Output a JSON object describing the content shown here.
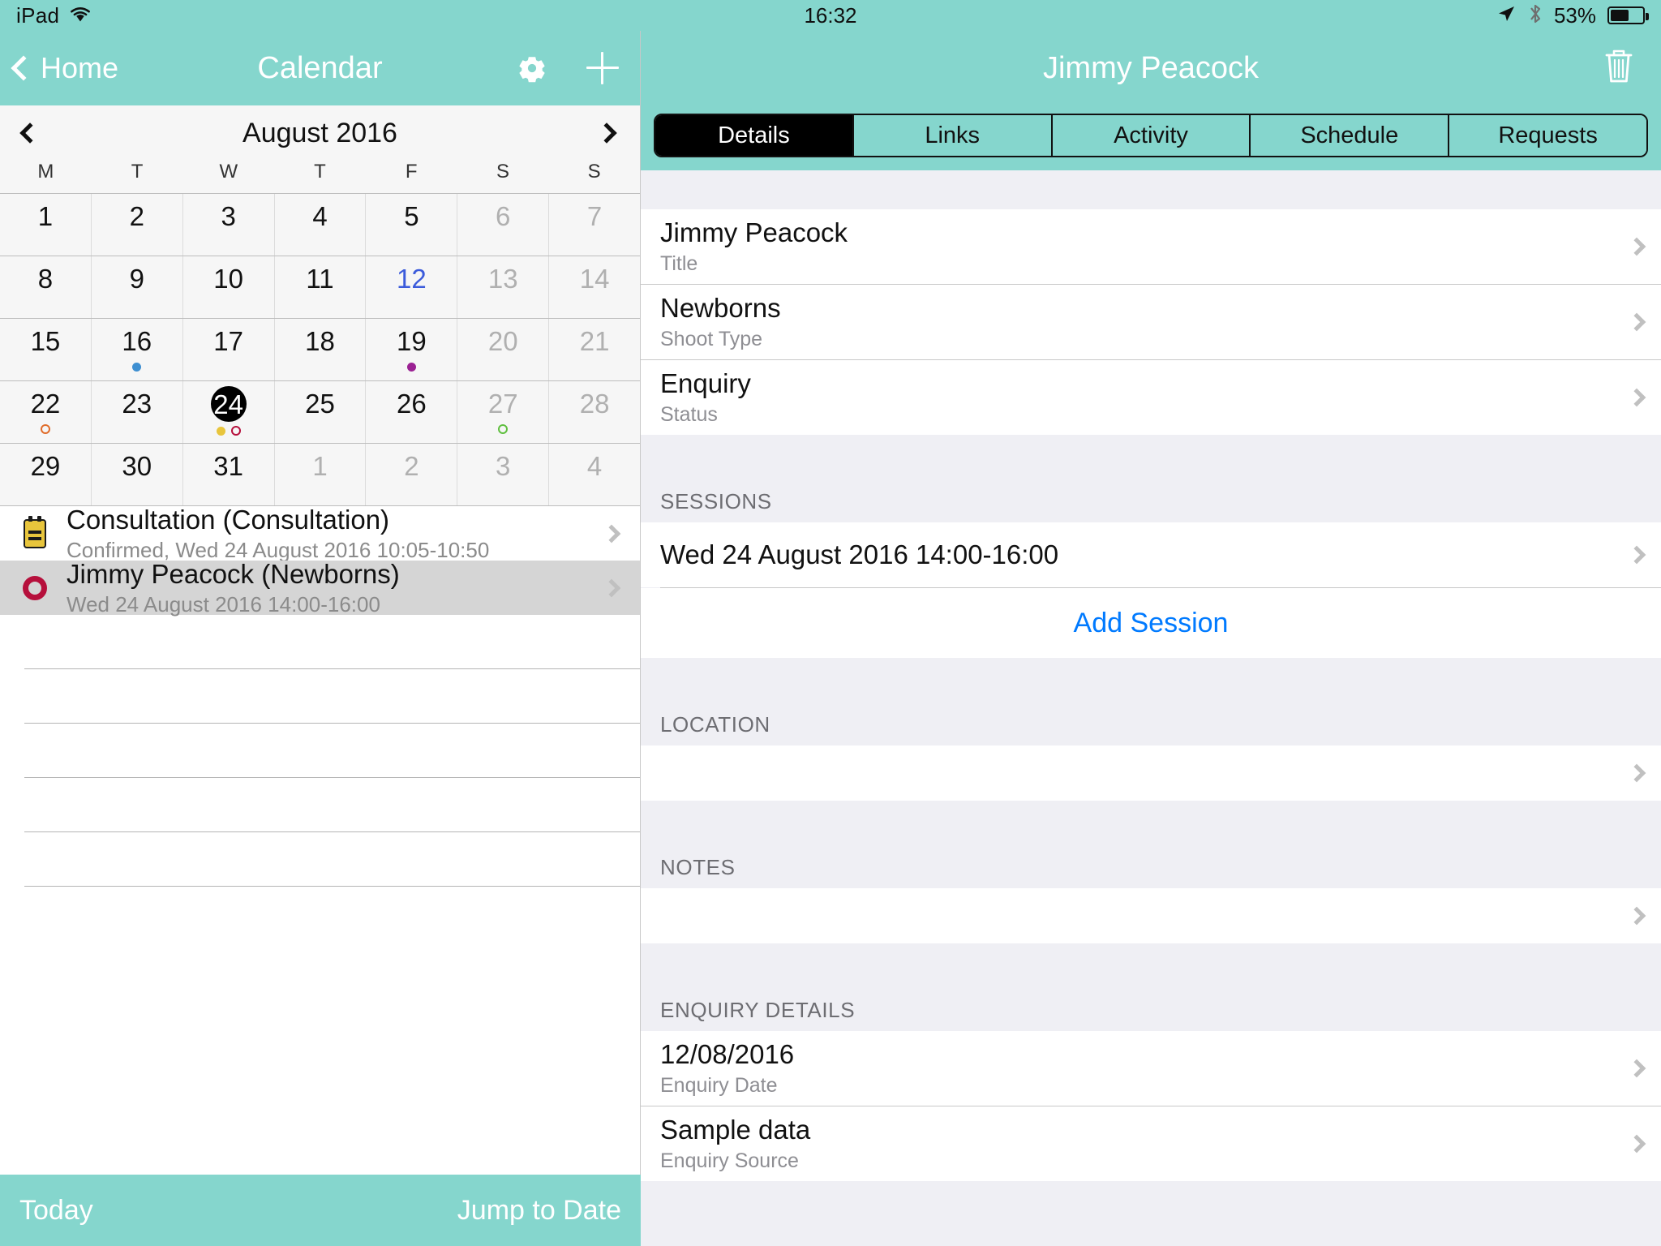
{
  "status_bar": {
    "device": "iPad",
    "wifi_icon": "wifi-icon",
    "time": "16:32",
    "location_icon": "location-arrow-icon",
    "bluetooth_icon": "bluetooth-icon",
    "battery_percent": "53%",
    "battery_level": 53
  },
  "left_pane": {
    "nav": {
      "back_label": "Home",
      "title": "Calendar",
      "gear_icon": "gear-icon",
      "plus_icon": "plus-icon"
    },
    "calendar": {
      "month_label": "August 2016",
      "prev_icon": "chevron-left-icon",
      "next_icon": "chevron-right-icon",
      "day_headers": [
        "M",
        "T",
        "W",
        "T",
        "F",
        "S",
        "S"
      ],
      "weeks": [
        [
          {
            "n": "1",
            "state": "normal",
            "dots": []
          },
          {
            "n": "2",
            "state": "normal",
            "dots": []
          },
          {
            "n": "3",
            "state": "normal",
            "dots": []
          },
          {
            "n": "4",
            "state": "normal",
            "dots": []
          },
          {
            "n": "5",
            "state": "normal",
            "dots": []
          },
          {
            "n": "6",
            "state": "weekend",
            "dots": []
          },
          {
            "n": "7",
            "state": "weekend",
            "dots": []
          }
        ],
        [
          {
            "n": "8",
            "state": "normal",
            "dots": []
          },
          {
            "n": "9",
            "state": "normal",
            "dots": []
          },
          {
            "n": "10",
            "state": "normal",
            "dots": []
          },
          {
            "n": "11",
            "state": "normal",
            "dots": []
          },
          {
            "n": "12",
            "state": "today",
            "dots": []
          },
          {
            "n": "13",
            "state": "weekend",
            "dots": []
          },
          {
            "n": "14",
            "state": "weekend",
            "dots": []
          }
        ],
        [
          {
            "n": "15",
            "state": "normal",
            "dots": []
          },
          {
            "n": "16",
            "state": "normal",
            "dots": [
              {
                "color": "#3E8FD1",
                "filled": true
              }
            ]
          },
          {
            "n": "17",
            "state": "normal",
            "dots": []
          },
          {
            "n": "18",
            "state": "normal",
            "dots": []
          },
          {
            "n": "19",
            "state": "normal",
            "dots": [
              {
                "color": "#9B2193",
                "filled": true
              }
            ]
          },
          {
            "n": "20",
            "state": "weekend",
            "dots": []
          },
          {
            "n": "21",
            "state": "weekend",
            "dots": []
          }
        ],
        [
          {
            "n": "22",
            "state": "normal",
            "dots": [
              {
                "color": "#E06C2A",
                "filled": false
              }
            ]
          },
          {
            "n": "23",
            "state": "normal",
            "dots": []
          },
          {
            "n": "24",
            "state": "selected",
            "dots": [
              {
                "color": "#E8C53C",
                "filled": true
              },
              {
                "color": "#B6103C",
                "filled": false
              }
            ]
          },
          {
            "n": "25",
            "state": "normal",
            "dots": []
          },
          {
            "n": "26",
            "state": "normal",
            "dots": []
          },
          {
            "n": "27",
            "state": "weekend",
            "dots": [
              {
                "color": "#5FBF3F",
                "filled": false
              }
            ]
          },
          {
            "n": "28",
            "state": "weekend",
            "dots": []
          }
        ],
        [
          {
            "n": "29",
            "state": "normal",
            "dots": []
          },
          {
            "n": "30",
            "state": "normal",
            "dots": []
          },
          {
            "n": "31",
            "state": "normal",
            "dots": []
          },
          {
            "n": "1",
            "state": "other",
            "dots": []
          },
          {
            "n": "2",
            "state": "other",
            "dots": []
          },
          {
            "n": "3",
            "state": "other",
            "dots": []
          },
          {
            "n": "4",
            "state": "other",
            "dots": []
          }
        ]
      ]
    },
    "events": [
      {
        "icon": "note-icon",
        "title": "Consultation (Consultation)",
        "subtitle": "Confirmed, Wed 24 August 2016 10:05-10:50",
        "selected": false
      },
      {
        "icon": "ring-icon",
        "title": "Jimmy Peacock (Newborns)",
        "subtitle": "Wed 24 August 2016 14:00-16:00",
        "selected": true
      }
    ],
    "toolbar": {
      "today_label": "Today",
      "jump_label": "Jump to Date"
    }
  },
  "right_pane": {
    "nav": {
      "title": "Jimmy Peacock",
      "trash_icon": "trash-icon"
    },
    "tabs": [
      {
        "label": "Details",
        "active": true
      },
      {
        "label": "Links",
        "active": false
      },
      {
        "label": "Activity",
        "active": false
      },
      {
        "label": "Schedule",
        "active": false
      },
      {
        "label": "Requests",
        "active": false
      }
    ],
    "detail_fields": [
      {
        "value": "Jimmy Peacock",
        "label": "Title"
      },
      {
        "value": "Newborns",
        "label": "Shoot Type"
      },
      {
        "value": "Enquiry",
        "label": "Status"
      }
    ],
    "sessions": {
      "header": "SESSIONS",
      "items": [
        "Wed 24 August 2016 14:00-16:00"
      ],
      "add_label": "Add Session"
    },
    "location": {
      "header": "LOCATION",
      "value": ""
    },
    "notes": {
      "header": "NOTES",
      "value": ""
    },
    "enquiry_details": {
      "header": "ENQUIRY DETAILS",
      "fields": [
        {
          "value": "12/08/2016",
          "label": "Enquiry Date"
        },
        {
          "value": "Sample data",
          "label": "Enquiry Source"
        }
      ]
    }
  },
  "colors": {
    "teal": "#85D6CD",
    "accent_blue": "#007AFF",
    "today_blue": "#3b5bdb",
    "selected_black": "#000000"
  }
}
